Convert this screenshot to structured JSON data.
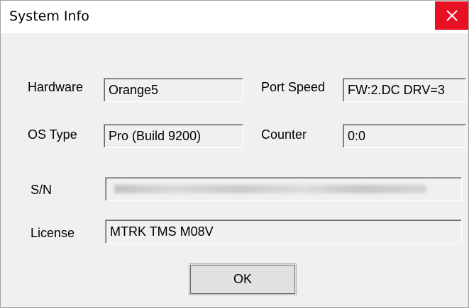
{
  "window": {
    "title": "System Info",
    "close_icon": "close-x-icon",
    "close_color": "#e81123"
  },
  "fields": {
    "hardware": {
      "label": "Hardware",
      "value": "Orange5"
    },
    "port_speed": {
      "label": "Port Speed",
      "value": "FW:2.DC DRV=3"
    },
    "os_type": {
      "label": "OS Type",
      "value": "Pro (Build 9200)"
    },
    "counter": {
      "label": "Counter",
      "value": "0:0"
    },
    "serial": {
      "label": "S/N",
      "value": ""
    },
    "license": {
      "label": "License",
      "value": "MTRK TMS M08V"
    }
  },
  "buttons": {
    "ok_label": "OK"
  }
}
